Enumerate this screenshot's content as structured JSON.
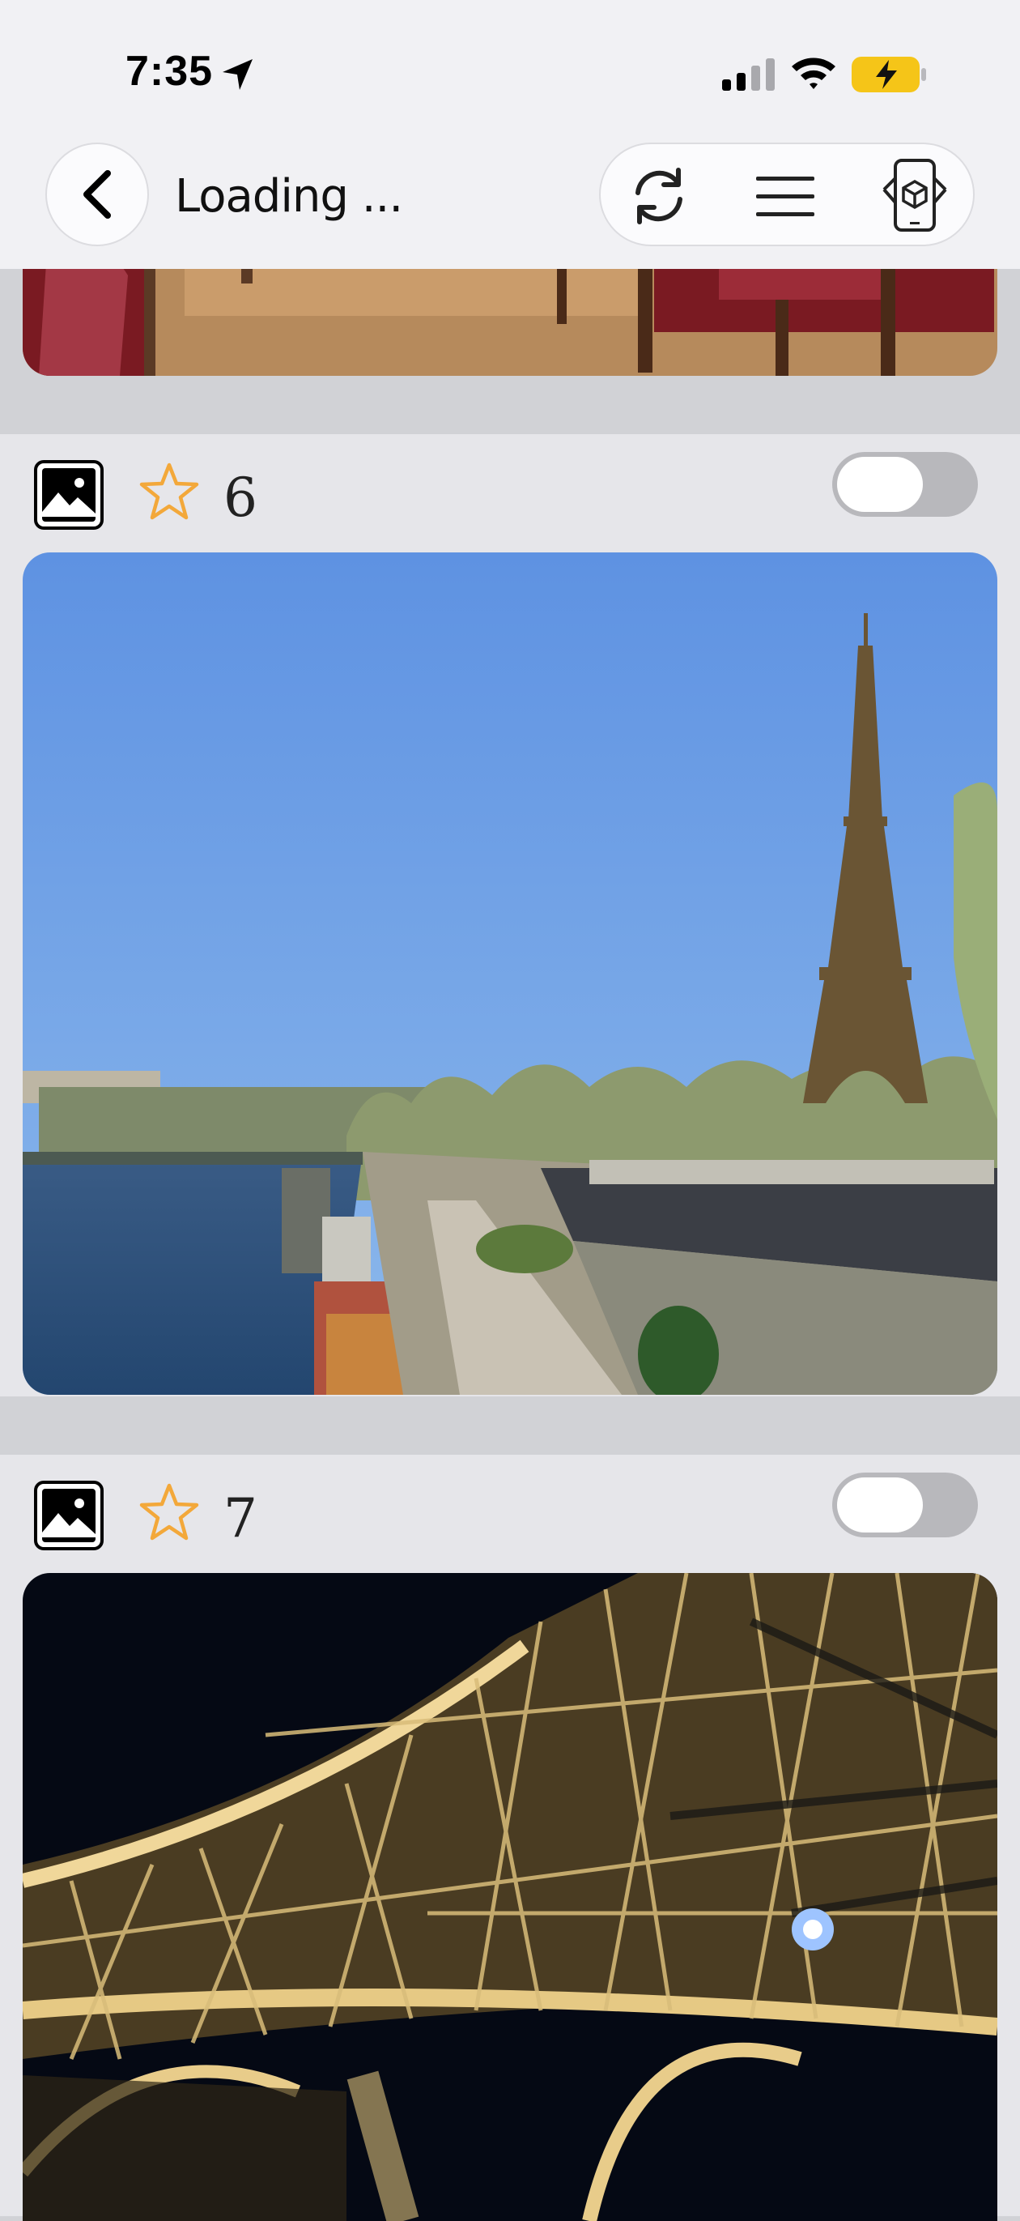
{
  "status_bar": {
    "time": "7:35",
    "icons": [
      "location-arrow-icon",
      "cellular-signal-icon",
      "wifi-icon",
      "battery-charging-icon"
    ],
    "battery_color": "#f5c518"
  },
  "header": {
    "title": "Loading ...",
    "actions": [
      "refresh-icon",
      "menu-icon",
      "ar-phone-icon"
    ]
  },
  "items": [
    {
      "type_icon": "photo-icon",
      "favorite_icon": "star-outline-icon",
      "count": "6",
      "toggle_on": false,
      "image": "eiffel-tower-seine-daytime"
    },
    {
      "type_icon": "photo-icon",
      "favorite_icon": "star-outline-icon",
      "count": "7",
      "toggle_on": false,
      "image": "eiffel-tower-underside-night"
    }
  ],
  "colors": {
    "star": "#f3a83a",
    "toggle_off": "#b8b8bc",
    "header_bg": "#f1f1f4"
  }
}
